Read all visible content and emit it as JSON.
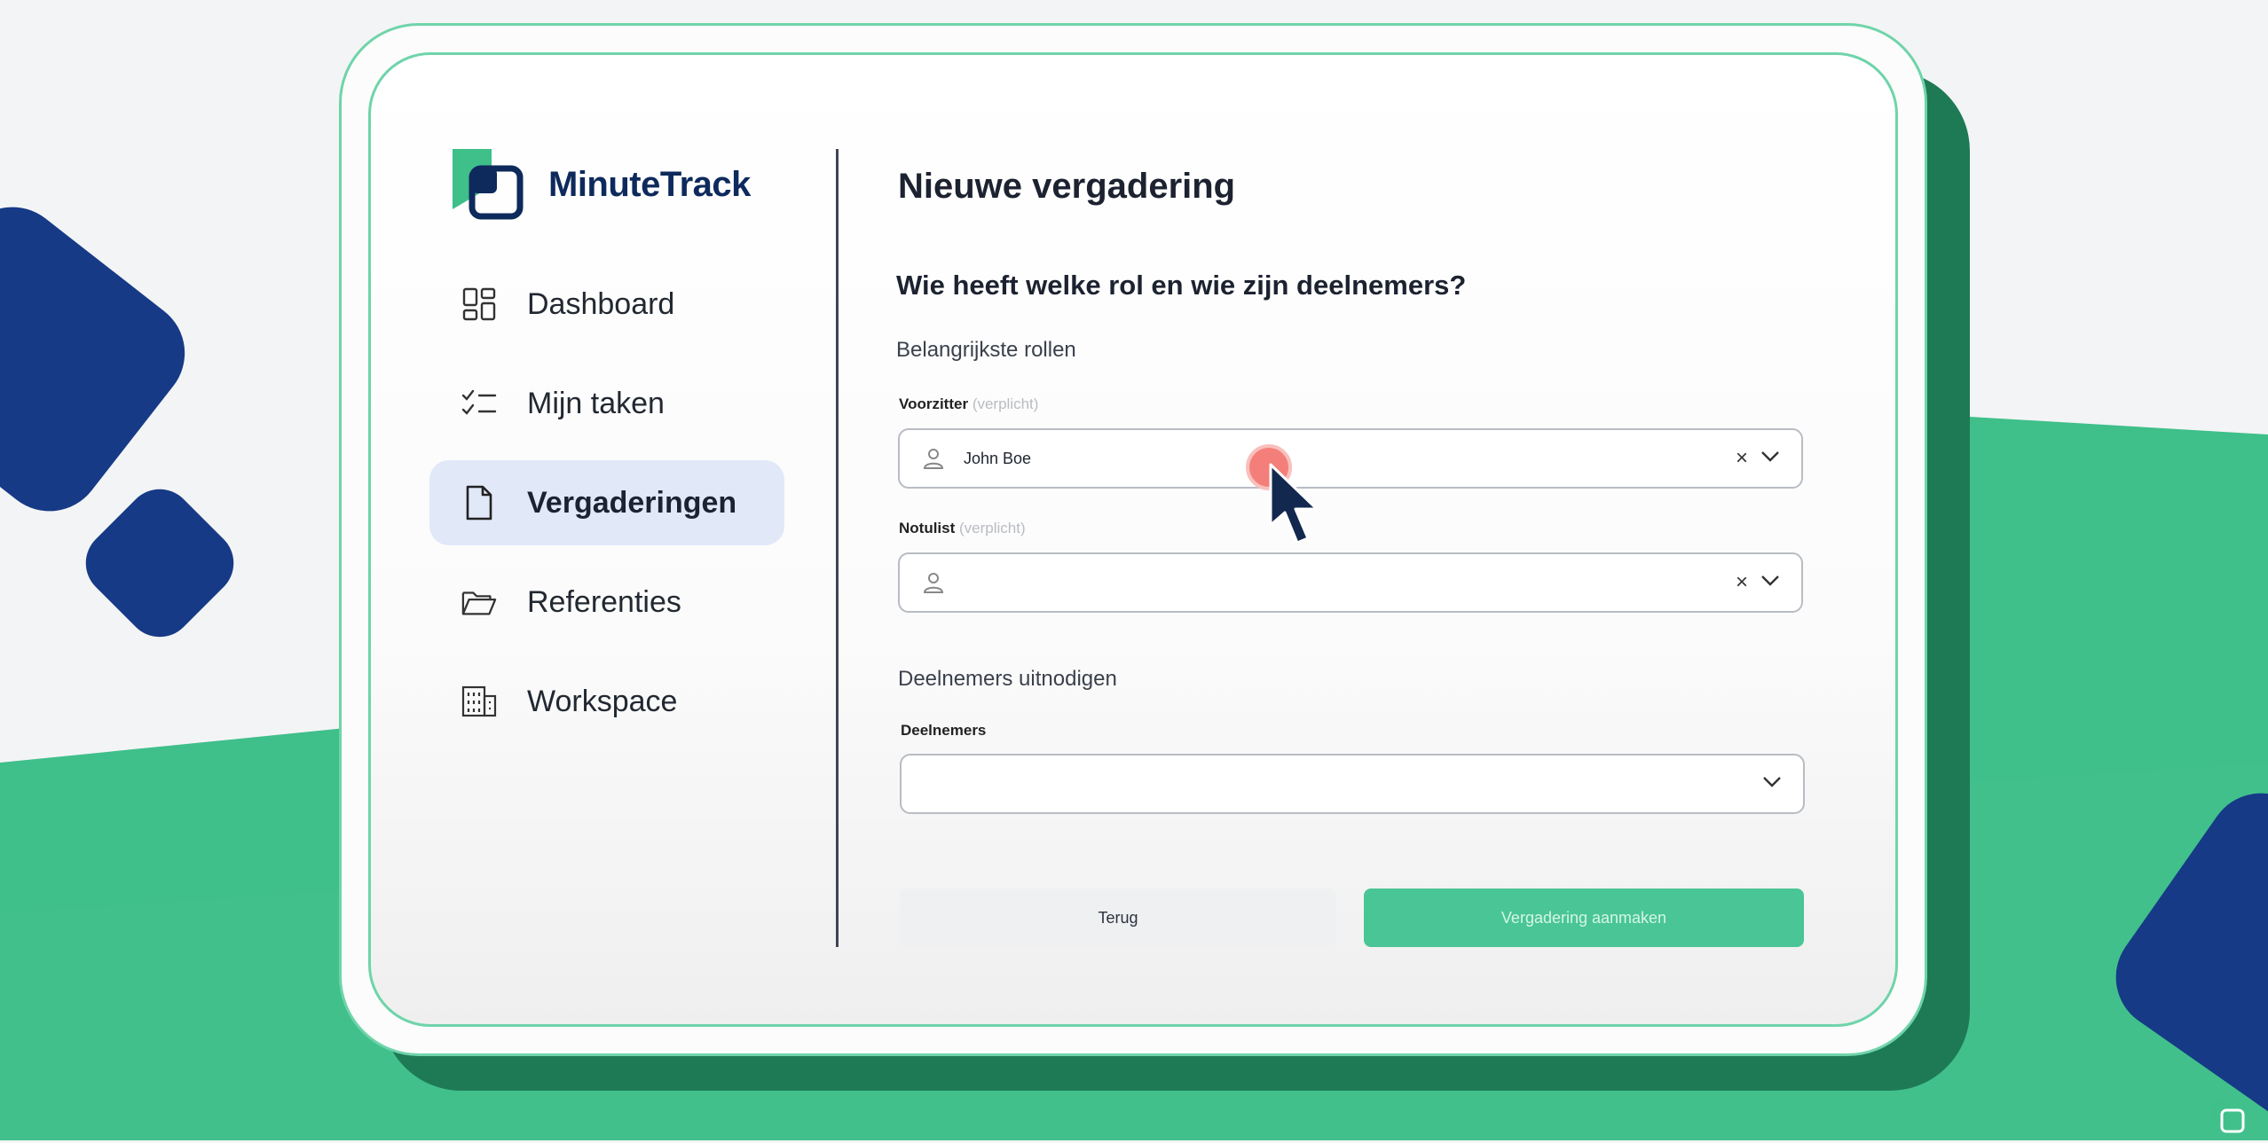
{
  "app": {
    "name": "MinuteTrack"
  },
  "sidebar": {
    "items": [
      {
        "label": "Dashboard",
        "icon": "dashboard-grid-icon",
        "active": false
      },
      {
        "label": "Mijn taken",
        "icon": "checklist-icon",
        "active": false
      },
      {
        "label": "Vergaderingen",
        "icon": "document-icon",
        "active": true
      },
      {
        "label": "Referenties",
        "icon": "folder-open-icon",
        "active": false
      },
      {
        "label": "Workspace",
        "icon": "building-icon",
        "active": false
      }
    ]
  },
  "main": {
    "title": "Nieuwe vergadering",
    "question": "Wie heeft welke rol en wie zijn deelnemers?",
    "roles_heading": "Belangrijkste rollen",
    "chair": {
      "label": "Voorzitter",
      "required": "(verplicht)",
      "value": "John Boe"
    },
    "secretary": {
      "label": "Notulist",
      "required": "(verplicht)",
      "value": ""
    },
    "invite_heading": "Deelnemers uitnodigen",
    "participants": {
      "label": "Deelnemers",
      "value": ""
    },
    "buttons": {
      "back": "Terug",
      "create": "Vergadering aanmaken"
    }
  },
  "colors": {
    "brand_green": "#49c596",
    "brand_navy": "#163a86",
    "active_nav_bg": "#e1e8f8"
  }
}
